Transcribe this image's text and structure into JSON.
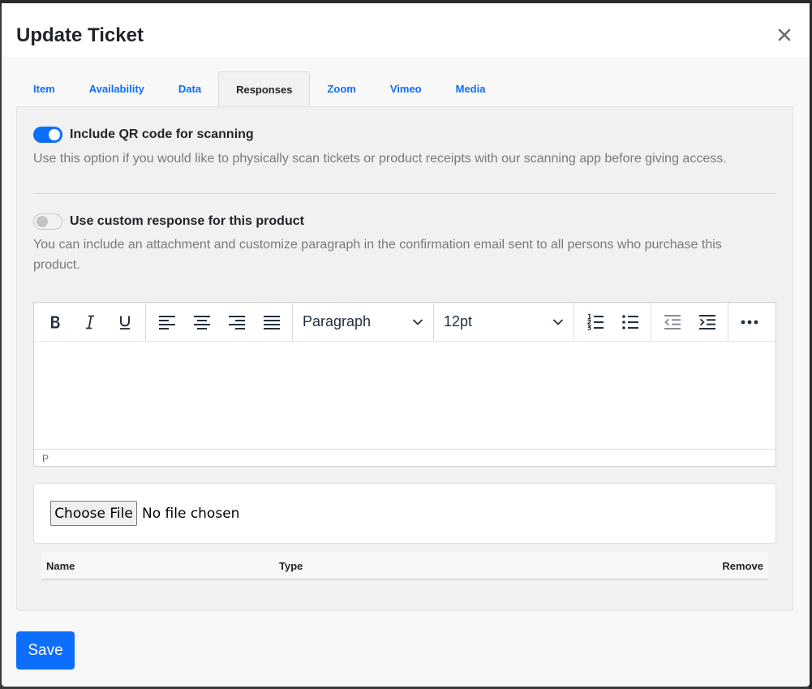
{
  "modal": {
    "title": "Update Ticket",
    "close_icon": "close-icon"
  },
  "tabs": [
    {
      "label": "Item",
      "active": false
    },
    {
      "label": "Availability",
      "active": false
    },
    {
      "label": "Data",
      "active": false
    },
    {
      "label": "Responses",
      "active": true
    },
    {
      "label": "Zoom",
      "active": false
    },
    {
      "label": "Vimeo",
      "active": false
    },
    {
      "label": "Media",
      "active": false
    }
  ],
  "qr": {
    "enabled": true,
    "label": "Include QR code for scanning",
    "help": "Use this option if you would like to physically scan tickets or product receipts with our scanning app before giving access."
  },
  "custom_response": {
    "enabled": false,
    "label": "Use custom response for this product",
    "help": "You can include an attachment and customize paragraph in the confirmation email sent to all persons who purchase this product."
  },
  "editor": {
    "block_format": "Paragraph",
    "font_size": "12pt",
    "status_path": "P",
    "icons": [
      "bold-icon",
      "italic-icon",
      "underline-icon",
      "align-left-icon",
      "align-center-icon",
      "align-right-icon",
      "align-justify-icon",
      "numbered-list-icon",
      "bullet-list-icon",
      "outdent-icon",
      "indent-icon",
      "more-icon"
    ]
  },
  "file_input": {
    "button_label": "Choose File",
    "status": "No file chosen"
  },
  "attachments_table": {
    "columns": [
      "Name",
      "Type",
      "Remove"
    ]
  },
  "footer": {
    "save_label": "Save"
  },
  "colors": {
    "accent": "#0d6efd"
  }
}
